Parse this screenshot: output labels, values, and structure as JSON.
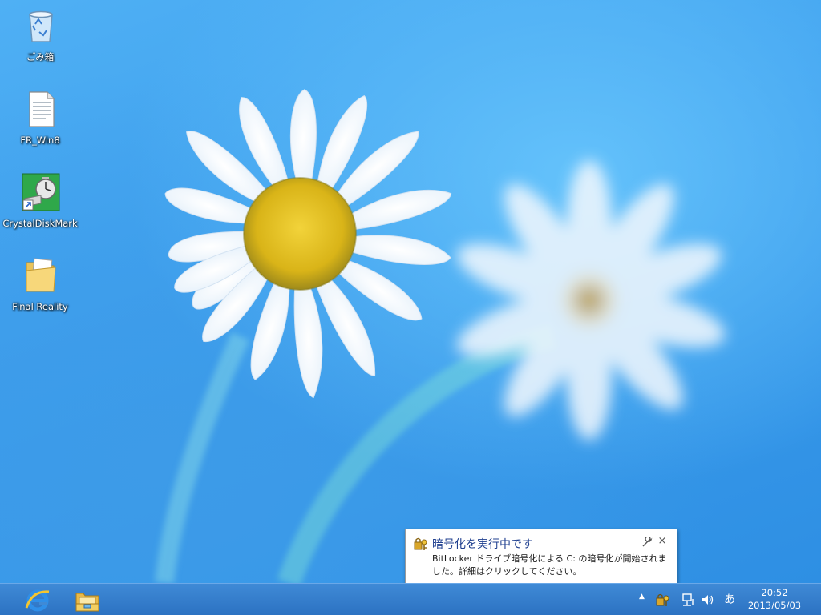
{
  "desktop": {
    "icons": [
      {
        "label": "ごみ箱",
        "icon": "recycle-bin-icon"
      },
      {
        "label": "FR_Win8",
        "icon": "text-document-icon"
      },
      {
        "label": "CrystalDiskMark",
        "icon": "crystaldiskmark-shortcut-icon"
      },
      {
        "label": "Final Reality",
        "icon": "folder-icon"
      }
    ]
  },
  "notification": {
    "title": "暗号化を実行中です",
    "body": "BitLocker ドライブ暗号化による C: の暗号化が開始されました。詳細はクリックしてください。",
    "icon": "bitlocker-key-icon",
    "close_glyph": "×"
  },
  "taskbar": {
    "pinned": [
      {
        "icon": "internet-explorer-icon"
      },
      {
        "icon": "file-explorer-icon"
      }
    ],
    "tray": {
      "overflow_glyph": "▲",
      "ime_indicator": "あ",
      "clock_time": "20:52",
      "clock_date": "2013/05/03"
    }
  },
  "colors": {
    "taskbar": "#2f78c8",
    "desktop": "#3c9eee",
    "balloon_title": "#1f3f8f"
  }
}
